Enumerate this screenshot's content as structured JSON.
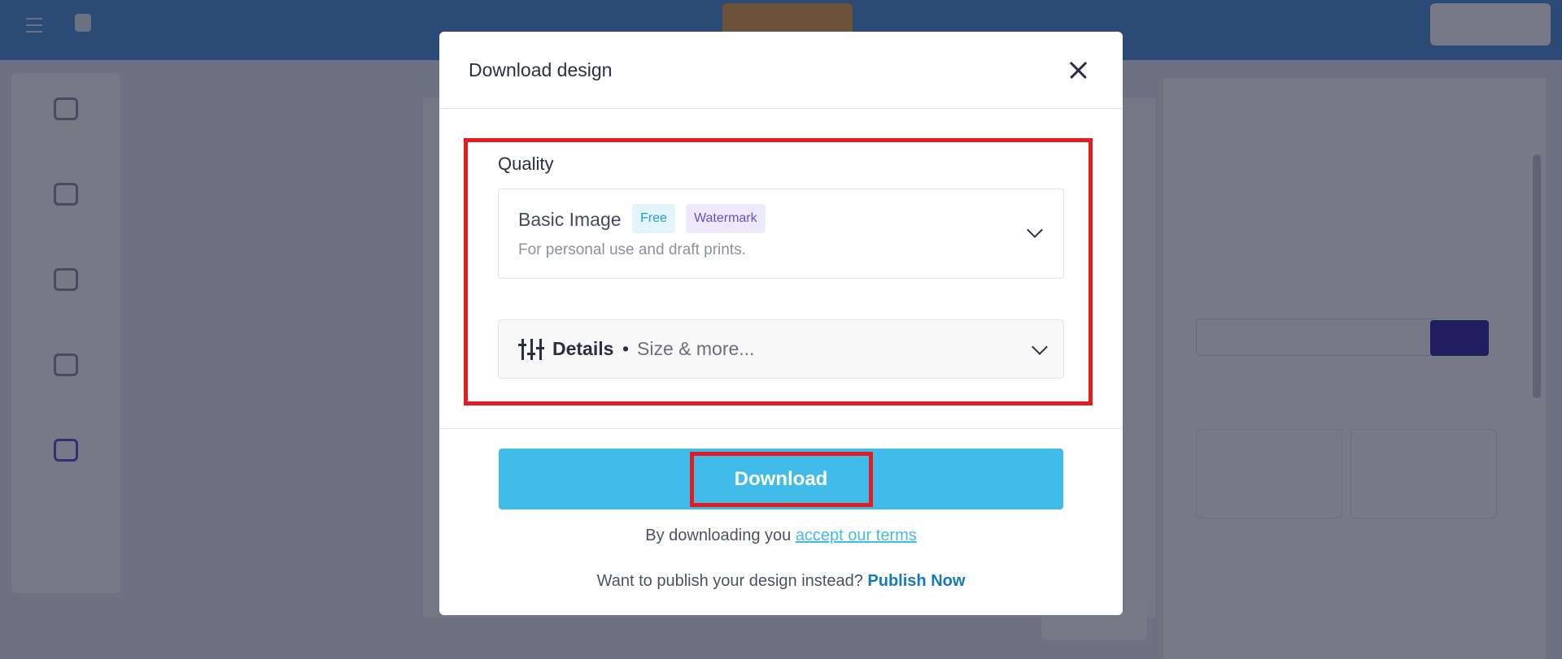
{
  "modal": {
    "title": "Download design",
    "quality": {
      "section_label": "Quality",
      "selected": "Basic Image",
      "badges": [
        "Free",
        "Watermark"
      ],
      "description": "For personal use and draft prints."
    },
    "details": {
      "label": "Details",
      "separator": "•",
      "subtitle": "Size & more..."
    },
    "download_button": "Download",
    "terms": {
      "prefix": "By downloading you",
      "link": "accept our terms"
    },
    "publish": {
      "prefix": "Want to publish your design instead?",
      "link": "Publish Now"
    }
  },
  "colors": {
    "primary_button": "#41bce8",
    "annotation_box": "#e11d22",
    "publish_link": "#1679b8",
    "badge_free": "#1f9fd6",
    "badge_watermark": "#6a4fc8"
  },
  "icons": [
    "close-icon",
    "chevron-down-icon",
    "sliders-icon"
  ]
}
